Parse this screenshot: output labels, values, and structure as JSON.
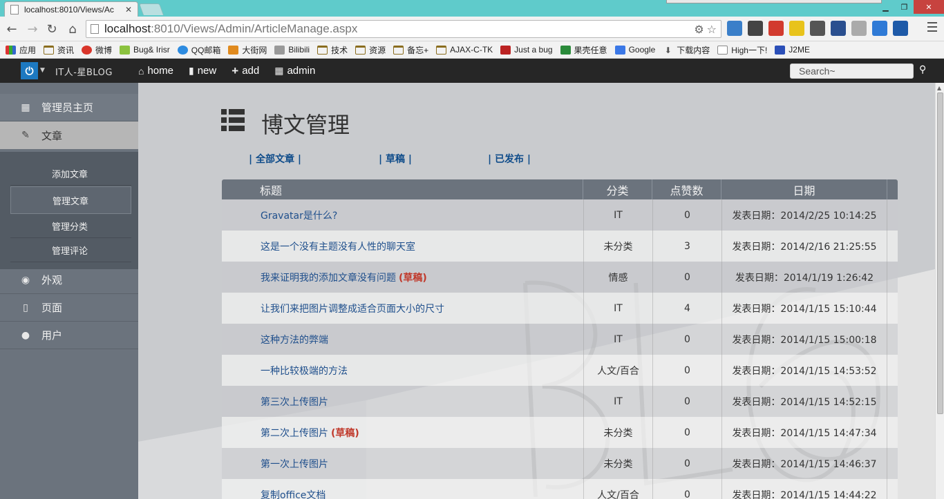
{
  "browser": {
    "tab_title": "localhost:8010/Views/Ac",
    "url_host": "localhost",
    "url_rest": ":8010/Views/Admin/ArticleManage.aspx",
    "bookmarks": [
      "应用",
      "资讯",
      "微博",
      "Bug& Irisr",
      "QQ邮箱",
      "大街网",
      "Bilibili",
      "技术",
      "资源",
      "备忘+",
      "AJAX-C-TK",
      "Just a bug",
      "果壳任意",
      "Google",
      "下载内容",
      "High一下!",
      "J2ME"
    ]
  },
  "site": {
    "brand": "IT人-星BLOG",
    "nav": [
      {
        "label": "home",
        "icon": "home-icon"
      },
      {
        "label": "new",
        "icon": "comment-icon"
      },
      {
        "label": "add",
        "icon": "plus-icon"
      },
      {
        "label": "admin",
        "icon": "grid-icon"
      }
    ],
    "search_placeholder": "Search~"
  },
  "sidebar": {
    "home": "管理员主页",
    "article": "文章",
    "sub": [
      "添加文章",
      "管理文章",
      "管理分类",
      "管理评论"
    ],
    "look": "外观",
    "page": "页面",
    "user": "用户"
  },
  "main": {
    "title": "博文管理",
    "filters": [
      "| 全部文章 |",
      "| 草稿 |",
      "| 已发布 |"
    ],
    "columns": [
      "标题",
      "分类",
      "点赞数",
      "日期"
    ],
    "draft_label": "(草稿)",
    "rows": [
      {
        "title": "Gravatar是什么?",
        "draft": false,
        "category": "IT",
        "likes": "0",
        "date": "发表日期：2014/2/25 10:14:25"
      },
      {
        "title": "这是一个没有主题没有人性的聊天室",
        "draft": false,
        "category": "未分类",
        "likes": "3",
        "date": "发表日期：2014/2/16 21:25:55"
      },
      {
        "title": "我来证明我的添加文章没有问题",
        "draft": true,
        "category": "情感",
        "likes": "0",
        "date": "发表日期：2014/1/19 1:26:42"
      },
      {
        "title": "让我们来把图片调整成适合页面大小的尺寸",
        "draft": false,
        "category": "IT",
        "likes": "4",
        "date": "发表日期：2014/1/15 15:10:44"
      },
      {
        "title": "这种方法的弊端",
        "draft": false,
        "category": "IT",
        "likes": "0",
        "date": "发表日期：2014/1/15 15:00:18"
      },
      {
        "title": "一种比较极端的方法",
        "draft": false,
        "category": "人文/百合",
        "likes": "0",
        "date": "发表日期：2014/1/15 14:53:52"
      },
      {
        "title": "第三次上传图片",
        "draft": false,
        "category": "IT",
        "likes": "0",
        "date": "发表日期：2014/1/15 14:52:15"
      },
      {
        "title": "第二次上传图片",
        "draft": true,
        "category": "未分类",
        "likes": "0",
        "date": "发表日期：2014/1/15 14:47:34"
      },
      {
        "title": "第一次上传图片",
        "draft": false,
        "category": "未分类",
        "likes": "0",
        "date": "发表日期：2014/1/15 14:46:37"
      },
      {
        "title": "复制office文档",
        "draft": false,
        "category": "人文/百合",
        "likes": "0",
        "date": "发表日期：2014/1/15 14:44:22"
      }
    ]
  }
}
